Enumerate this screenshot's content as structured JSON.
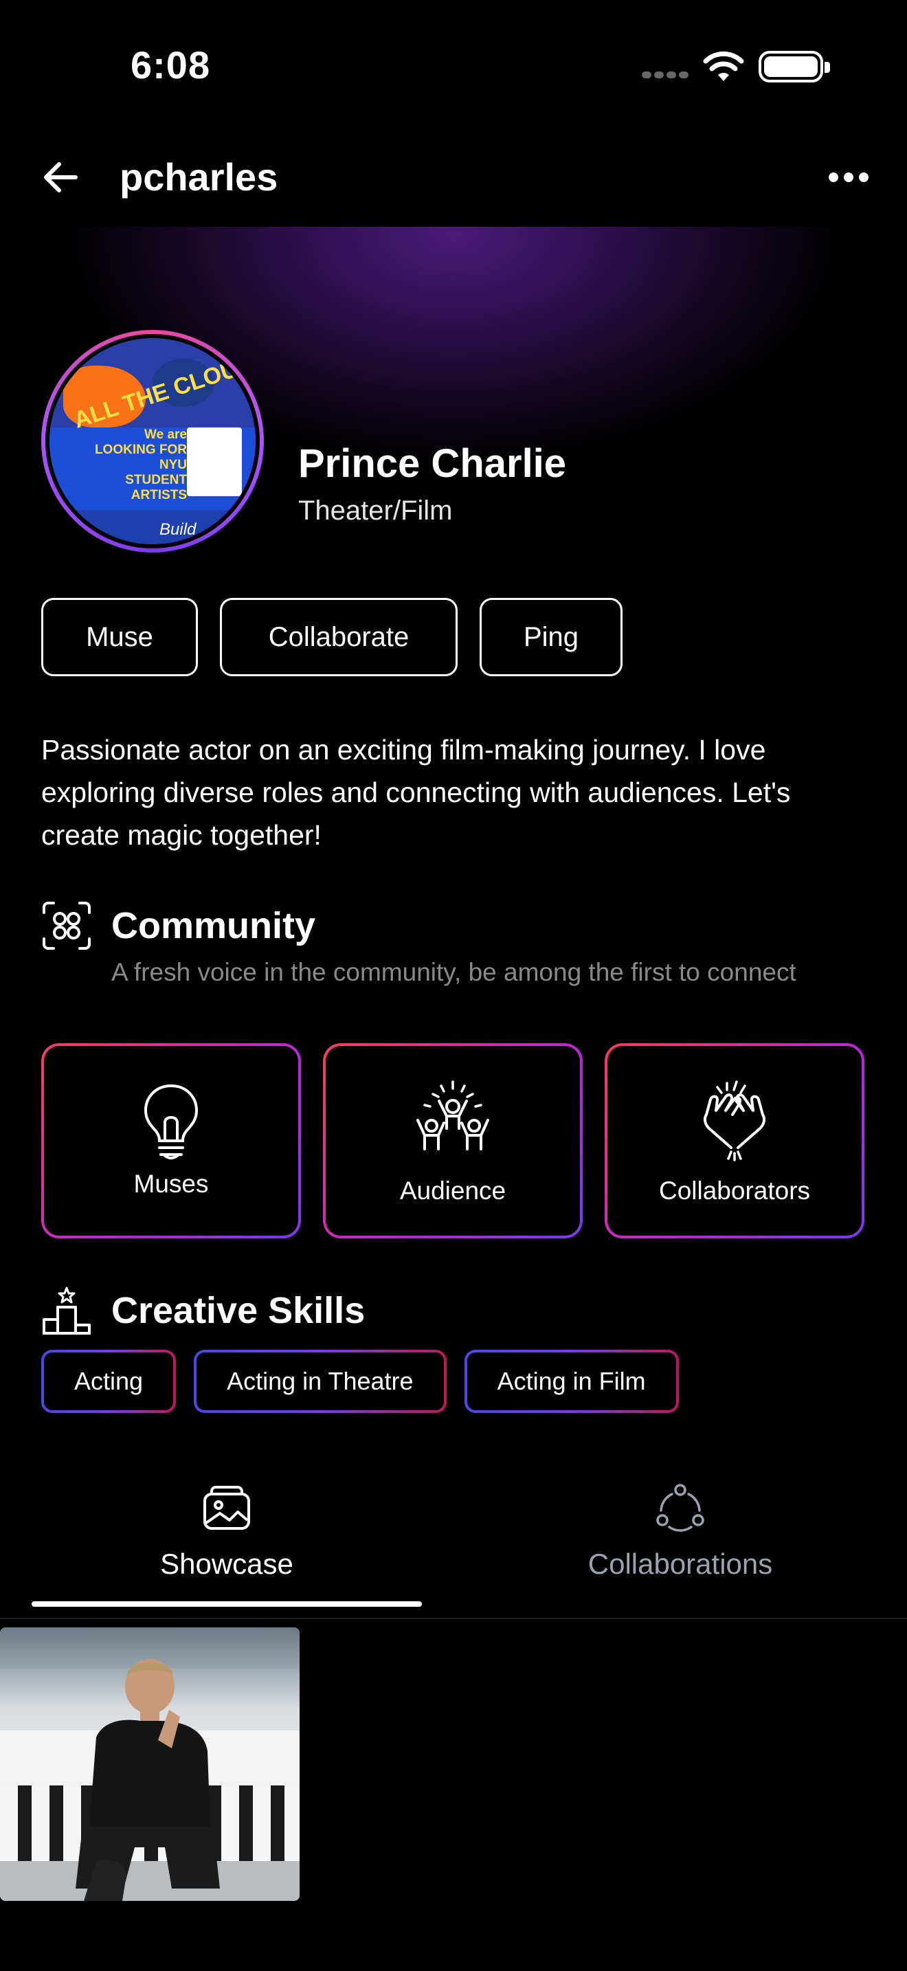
{
  "status_bar": {
    "time": "6:08"
  },
  "header": {
    "username": "pcharles"
  },
  "profile": {
    "display_name": "Prince Charlie",
    "discipline": "Theater/Film",
    "avatar_poster_lines": [
      "We are LOOKING FOR",
      "NYU",
      "STUDENT",
      "ARTISTS"
    ],
    "avatar_scribble": "ALL THE CLOUT",
    "avatar_bottom": "Build"
  },
  "actions": {
    "muse": "Muse",
    "collaborate": "Collaborate",
    "ping": "Ping"
  },
  "bio": "Passionate actor on an exciting film-making journey. I love exploring diverse roles and connecting with audiences. Let's create magic together!",
  "community": {
    "title": "Community",
    "subtitle": "A fresh voice in the community, be among the first to connect",
    "cards": [
      {
        "label": "Muses",
        "icon": "lightbulb-icon"
      },
      {
        "label": "Audience",
        "icon": "cheering-crowd-icon"
      },
      {
        "label": "Collaborators",
        "icon": "high-five-icon"
      }
    ]
  },
  "skills": {
    "title": "Creative Skills",
    "items": [
      "Acting",
      "Acting in Theatre",
      "Acting in Film"
    ]
  },
  "tabs": [
    {
      "label": "Showcase",
      "icon": "gallery-icon",
      "active": true
    },
    {
      "label": "Collaborations",
      "icon": "network-icon",
      "active": false
    }
  ],
  "colors": {
    "background": "#000000",
    "accent_purple": "#7c3aed",
    "accent_pink": "#f43f5e",
    "muted_text": "#8a8a8a"
  }
}
